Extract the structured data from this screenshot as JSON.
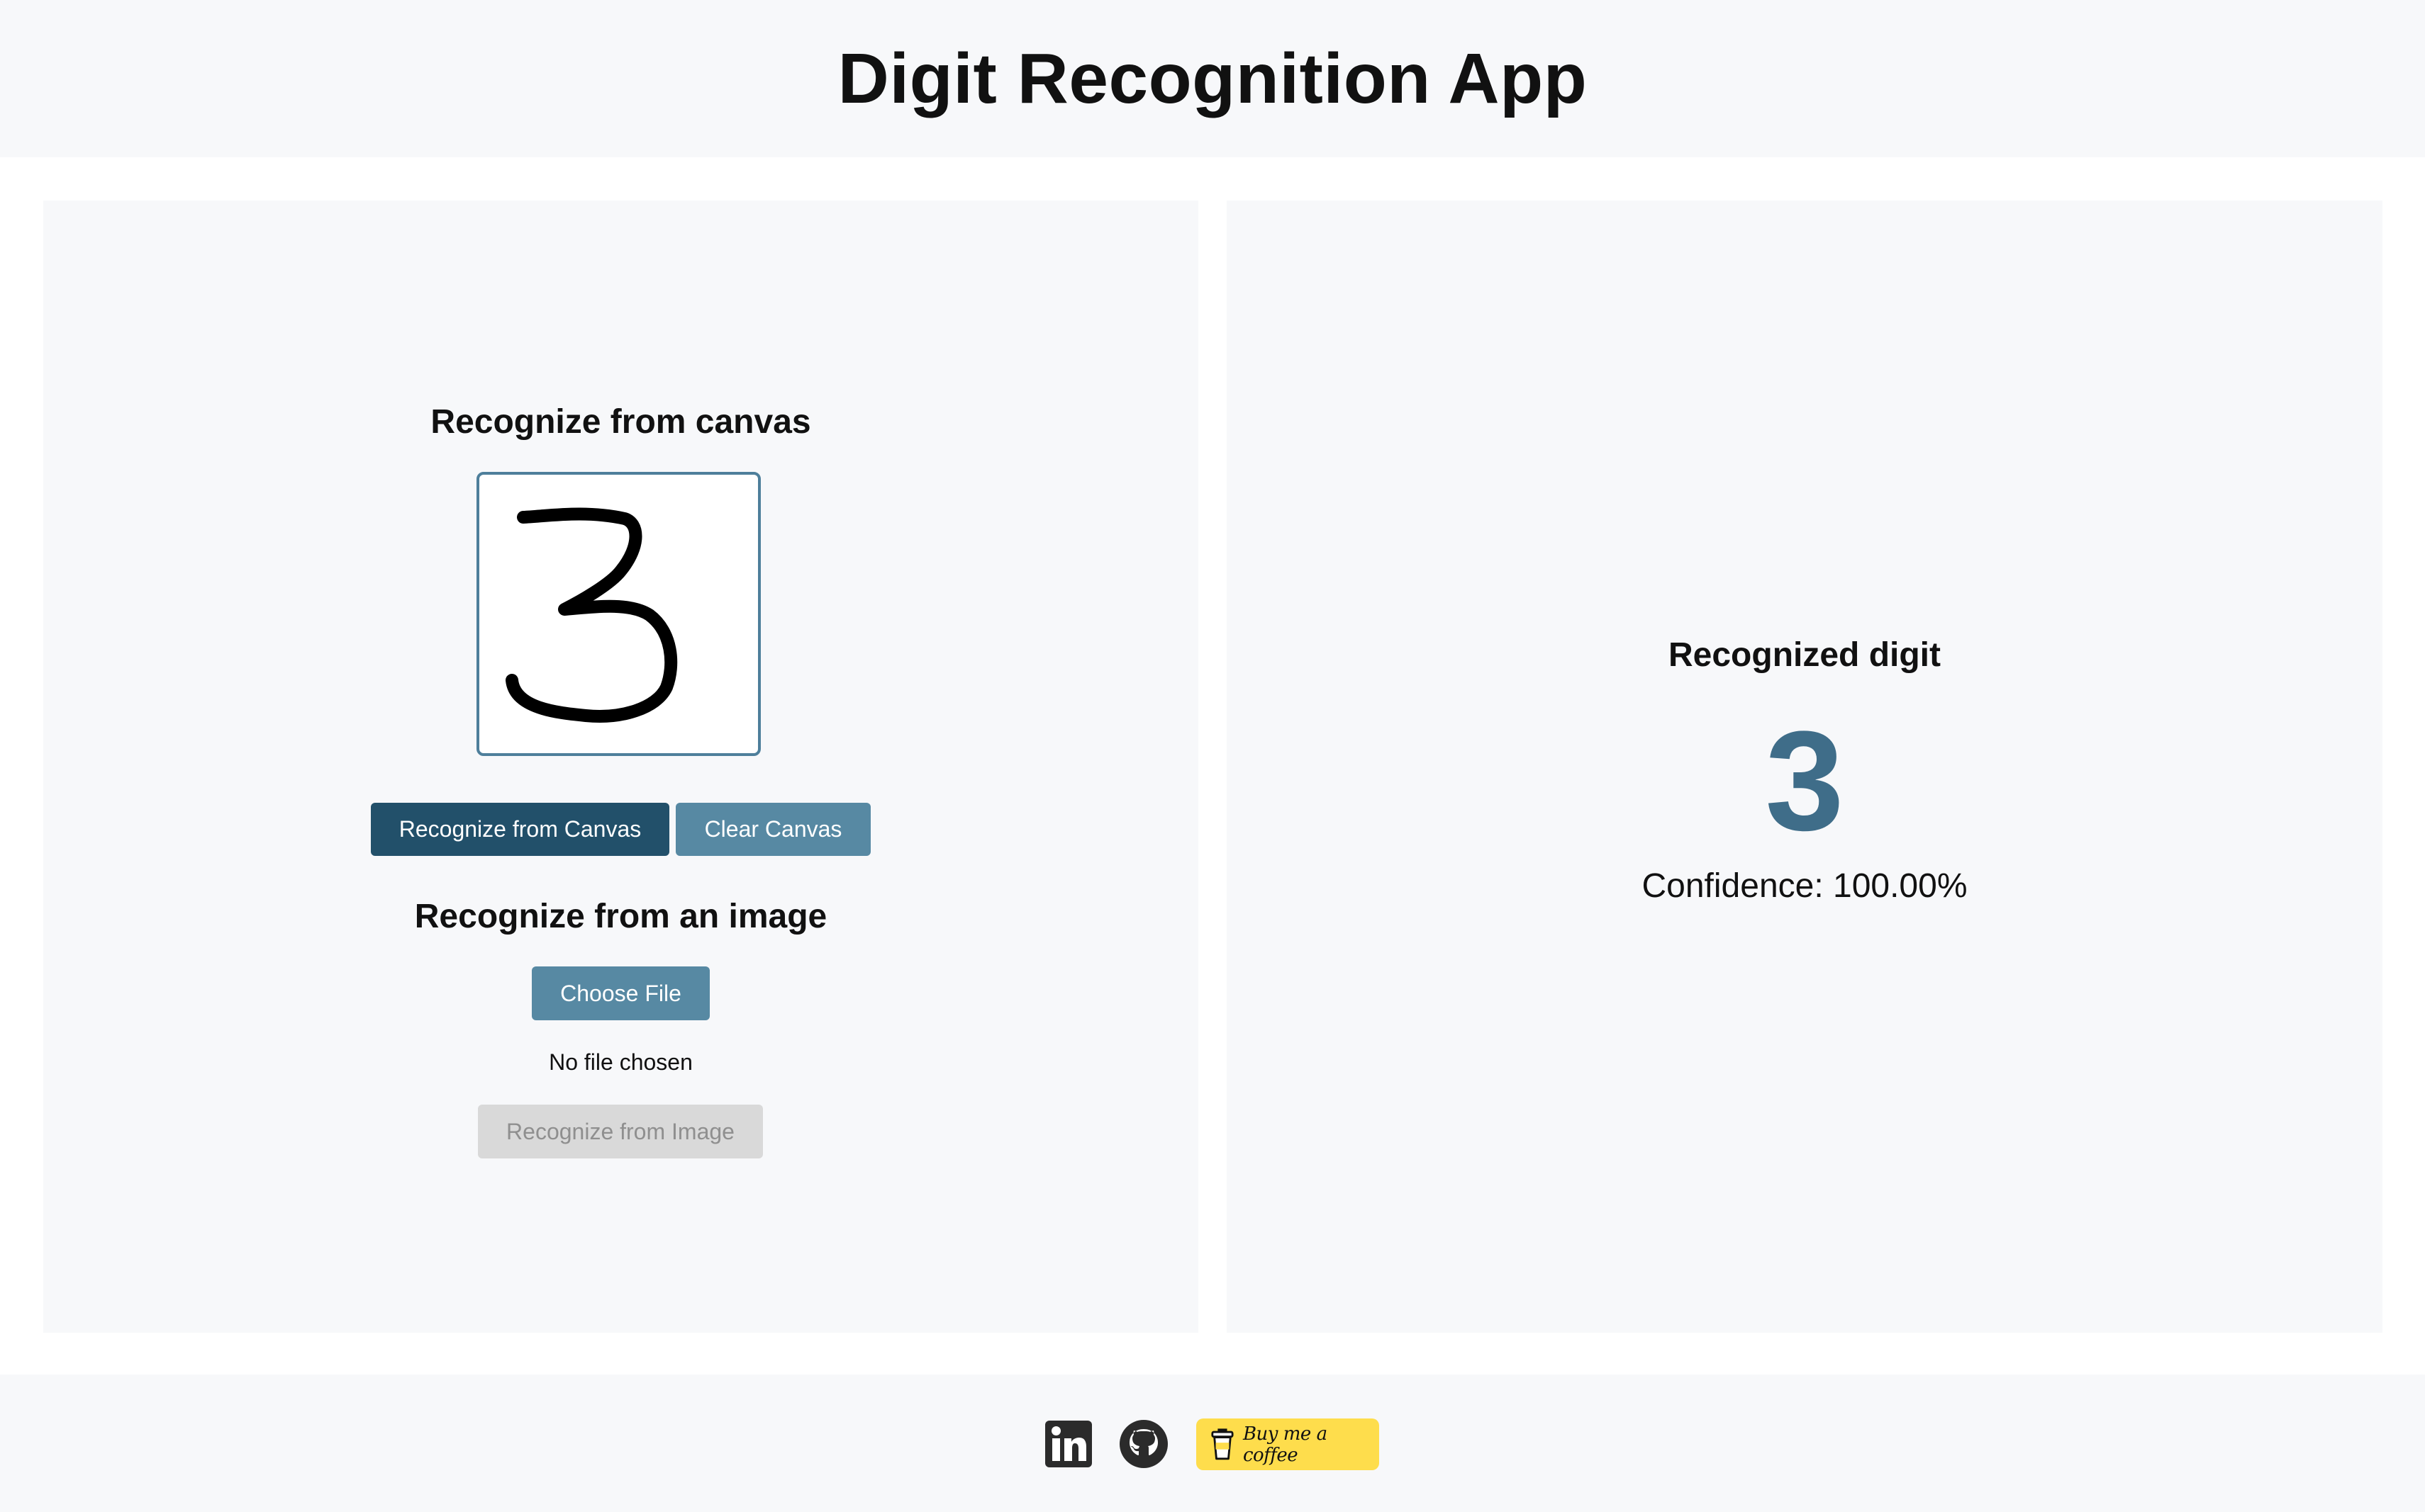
{
  "app": {
    "title": "Digit Recognition App"
  },
  "canvas_section": {
    "title": "Recognize from canvas",
    "drawn_digit_icon": "handwritten-3-stroke",
    "recognize_button": "Recognize from Canvas",
    "clear_button": "Clear Canvas"
  },
  "image_section": {
    "title": "Recognize from an image",
    "choose_file_button": "Choose File",
    "file_status": "No file chosen",
    "recognize_button": "Recognize from Image"
  },
  "result": {
    "title": "Recognized digit",
    "digit": "3",
    "confidence": "Confidence: 100.00%"
  },
  "footer": {
    "linkedin_icon": "linkedin-icon",
    "github_icon": "github-icon",
    "coffee_label": "Buy me a coffee"
  },
  "colors": {
    "primary_dark": "#22506a",
    "primary_mid": "#5789a3",
    "digit_color": "#3f6d89",
    "panel_bg": "#f7f8fa",
    "coffee_yellow": "#fedd4c"
  }
}
